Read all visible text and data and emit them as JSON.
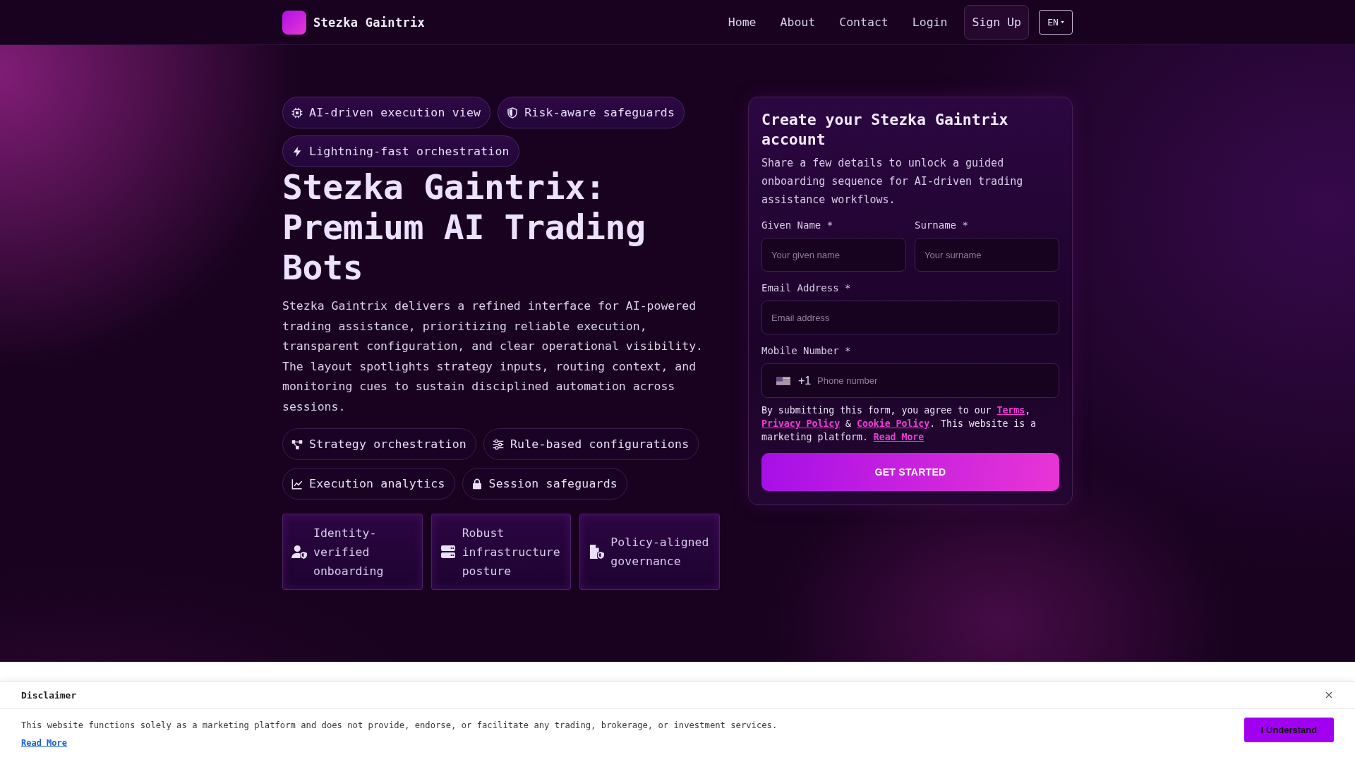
{
  "nav": {
    "brand": "Stezka Gaintrix",
    "links": [
      "Home",
      "About",
      "Contact",
      "Login"
    ],
    "signup": "Sign Up",
    "language": "EN"
  },
  "hero": {
    "badges": [
      "AI-driven execution view",
      "Risk-aware safeguards",
      "Lightning-fast orchestration"
    ],
    "title": "Stezka Gaintrix: Premium AI Trading Bots",
    "description": "Stezka Gaintrix delivers a refined interface for AI-powered trading assistance, prioritizing reliable execution, transparent configuration, and clear operational visibility. The layout spotlights strategy inputs, routing context, and monitoring cues to sustain disciplined automation across sessions.",
    "features": [
      "Strategy orchestration",
      "Rule-based configurations",
      "Execution analytics",
      "Session safeguards"
    ],
    "cards": [
      "Identity-verified onboarding",
      "Robust infrastructure posture",
      "Policy-aligned governance"
    ]
  },
  "form": {
    "title": "Create your Stezka Gaintrix account",
    "description": "Share a few details to unlock a guided onboarding sequence for AI-driven trading assistance workflows.",
    "name_fields": [
      {
        "label": "Given Name *",
        "placeholder": "Your given name"
      },
      {
        "label": "Surname *",
        "placeholder": "Your surname"
      }
    ],
    "email": {
      "label": "Email Address *",
      "placeholder": "Email address"
    },
    "phone": {
      "label": "Mobile Number *",
      "dial_code": "+1",
      "placeholder": "Phone number"
    },
    "consent": [
      {
        "kind": "text",
        "text": "By submitting this form, you agree to our "
      },
      {
        "kind": "link",
        "text": "Terms"
      },
      {
        "kind": "text",
        "text": ", "
      },
      {
        "kind": "link",
        "text": "Privacy Policy"
      },
      {
        "kind": "text",
        "text": " & "
      },
      {
        "kind": "link",
        "text": "Cookie Policy"
      },
      {
        "kind": "text",
        "text": ". This website is a marketing platform. "
      },
      {
        "kind": "link",
        "text": "Read More"
      }
    ],
    "submit": "GET STARTED"
  },
  "disclaimer": {
    "title": "Disclaimer",
    "text": "This website functions solely as a marketing platform and does not provide, endorse, or facilitate any trading, brokerage, or investment services.",
    "link": "Read More",
    "button": "I Understand"
  }
}
